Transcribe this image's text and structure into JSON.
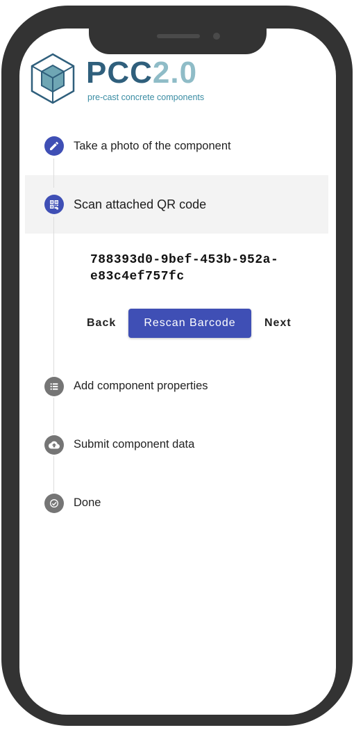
{
  "app": {
    "logo_main": "PCC",
    "logo_version": "2.0",
    "logo_subtitle": "pre-cast concrete components"
  },
  "colors": {
    "accent": "#3f4fb5",
    "inactive_icon": "#757575",
    "logo_dark": "#2f5f7c",
    "logo_light": "#8fbcc7"
  },
  "steps": [
    {
      "label": "Take a photo of the component",
      "icon": "pencil-icon",
      "state": "completed"
    },
    {
      "label": "Scan attached QR code",
      "icon": "qr-code-icon",
      "state": "active"
    },
    {
      "label": "Add component properties",
      "icon": "list-icon",
      "state": "pending"
    },
    {
      "label": "Submit component data",
      "icon": "cloud-upload-icon",
      "state": "pending"
    },
    {
      "label": "Done",
      "icon": "check-circle-icon",
      "state": "pending"
    }
  ],
  "scan": {
    "result_line1": "788393d0-9bef-453b-952a-",
    "result_line2": "e83c4ef757fc",
    "back_label": "Back",
    "rescan_label": "Rescan Barcode",
    "next_label": "Next"
  }
}
